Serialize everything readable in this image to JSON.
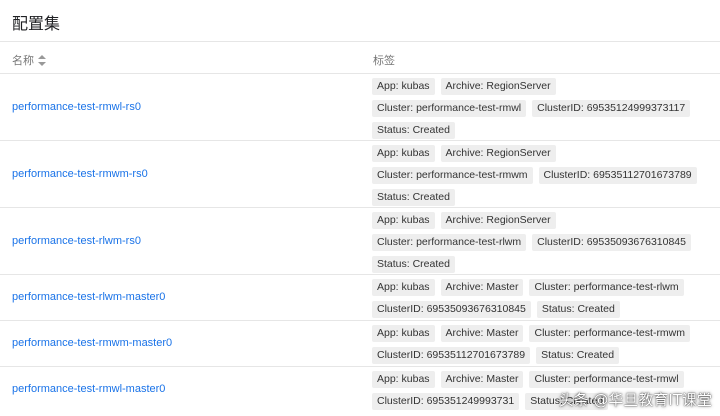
{
  "page": {
    "title": "配置集"
  },
  "table": {
    "headers": {
      "name": "名称",
      "labels": "标签"
    },
    "rows": [
      {
        "name": "performance-test-rmwl-rs0",
        "labels": [
          "App: kubas",
          "Archive: RegionServer",
          "Cluster: performance-test-rmwl",
          "ClusterID: 69535124999373117",
          "Status: Created"
        ]
      },
      {
        "name": "performance-test-rmwm-rs0",
        "labels": [
          "App: kubas",
          "Archive: RegionServer",
          "Cluster: performance-test-rmwm",
          "ClusterID: 69535112701673789",
          "Status: Created"
        ]
      },
      {
        "name": "performance-test-rlwm-rs0",
        "labels": [
          "App: kubas",
          "Archive: RegionServer",
          "Cluster: performance-test-rlwm",
          "ClusterID: 69535093676310845",
          "Status: Created"
        ]
      },
      {
        "name": "performance-test-rlwm-master0",
        "labels": [
          "App: kubas",
          "Archive: Master",
          "Cluster: performance-test-rlwm",
          "ClusterID: 69535093676310845",
          "Status: Created"
        ]
      },
      {
        "name": "performance-test-rmwm-master0",
        "labels": [
          "App: kubas",
          "Archive: Master",
          "Cluster: performance-test-rmwm",
          "ClusterID: 69535112701673789",
          "Status: Created"
        ]
      },
      {
        "name": "performance-test-rmwl-master0",
        "labels": [
          "App: kubas",
          "Archive: Master",
          "Cluster: performance-test-rmwl",
          "ClusterID: 695351249993731",
          "Status: Created"
        ]
      }
    ]
  },
  "watermark": "头条 @华旦教育IT课堂"
}
